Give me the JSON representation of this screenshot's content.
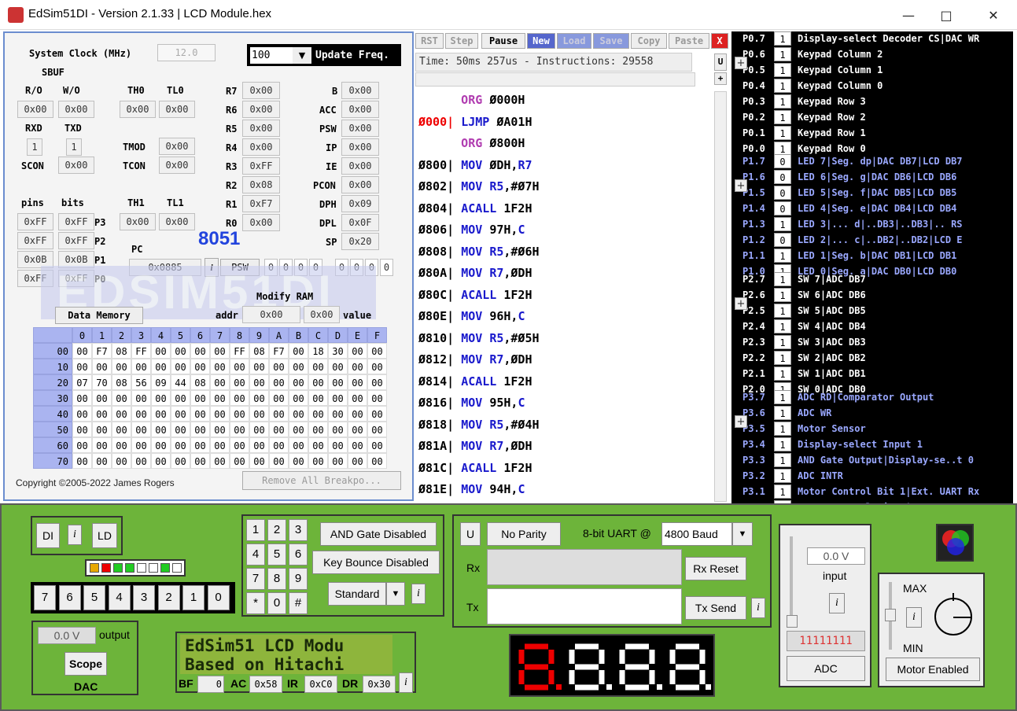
{
  "window": {
    "title": "EdSim51DI - Version 2.1.33 | LCD Module.hex"
  },
  "left": {
    "sysclock_label": "System Clock (MHz)",
    "sysclock_value": "12.0",
    "update_value": "100",
    "update_label": "Update Freq.",
    "sbuf": "SBUF",
    "ro": "R/O",
    "wo": "W/O",
    "ro_val": "0x00",
    "wo_val": "0x00",
    "rxd": "RXD",
    "txd": "TXD",
    "rxd_val": "1",
    "txd_val": "1",
    "scon": "SCON",
    "scon_val": "0x00",
    "th0": "TH0",
    "tl0": "TL0",
    "th0_val": "0x00",
    "tl0_val": "0x00",
    "tmod": "TMOD",
    "tmod_val": "0x00",
    "tcon": "TCON",
    "tcon_val": "0x00",
    "th1": "TH1",
    "tl1": "TL1",
    "th1_val": "0x00",
    "tl1_val": "0x00",
    "regs": [
      [
        "R7",
        "0x00"
      ],
      [
        "R6",
        "0x00"
      ],
      [
        "R5",
        "0x00"
      ],
      [
        "R4",
        "0x00"
      ],
      [
        "R3",
        "0xFF"
      ],
      [
        "R2",
        "0x08"
      ],
      [
        "R1",
        "0xF7"
      ],
      [
        "R0",
        "0x00"
      ]
    ],
    "sfrs": [
      [
        "B",
        "0x00"
      ],
      [
        "ACC",
        "0x00"
      ],
      [
        "PSW",
        "0x00"
      ],
      [
        "IP",
        "0x00"
      ],
      [
        "IE",
        "0x00"
      ],
      [
        "PCON",
        "0x00"
      ],
      [
        "DPH",
        "0x09"
      ],
      [
        "DPL",
        "0x0F"
      ],
      [
        "SP",
        "0x20"
      ]
    ],
    "pins": "pins",
    "bits": "bits",
    "ports": [
      [
        "0xFF",
        "0xFF",
        "P3"
      ],
      [
        "0xFF",
        "0xFF",
        "P2"
      ],
      [
        "0x0B",
        "0x0B",
        "P1"
      ],
      [
        "0xFF",
        "0xFF",
        "P0"
      ]
    ],
    "chip": "8051",
    "pc": "PC",
    "pc_val": "0x0885",
    "psw_btn": "PSW",
    "psw_bits": [
      "0",
      "0",
      "0",
      "0",
      "0",
      "0",
      "0",
      "0"
    ],
    "modify_ram": "Modify RAM",
    "addr": "addr",
    "addr_val": "0x00",
    "value_val": "0x00",
    "value": "value",
    "data_memory": "Data Memory",
    "copyright": "Copyright ©2005-2022 James Rogers",
    "remove_bp": "Remove All Breakpo...",
    "logo": "EDSIM51DI",
    "mem_cols": [
      "0",
      "1",
      "2",
      "3",
      "4",
      "5",
      "6",
      "7",
      "8",
      "9",
      "A",
      "B",
      "C",
      "D",
      "E",
      "F"
    ],
    "mem_rows": [
      [
        "00",
        "00",
        "F7",
        "08",
        "FF",
        "00",
        "00",
        "00",
        "00",
        "FF",
        "08",
        "F7",
        "00",
        "18",
        "30",
        "00",
        "00"
      ],
      [
        "10",
        "00",
        "00",
        "00",
        "00",
        "00",
        "00",
        "00",
        "00",
        "00",
        "00",
        "00",
        "00",
        "00",
        "00",
        "00",
        "00"
      ],
      [
        "20",
        "07",
        "70",
        "08",
        "56",
        "09",
        "44",
        "08",
        "00",
        "00",
        "00",
        "00",
        "00",
        "00",
        "00",
        "00",
        "00"
      ],
      [
        "30",
        "00",
        "00",
        "00",
        "00",
        "00",
        "00",
        "00",
        "00",
        "00",
        "00",
        "00",
        "00",
        "00",
        "00",
        "00",
        "00"
      ],
      [
        "40",
        "00",
        "00",
        "00",
        "00",
        "00",
        "00",
        "00",
        "00",
        "00",
        "00",
        "00",
        "00",
        "00",
        "00",
        "00",
        "00"
      ],
      [
        "50",
        "00",
        "00",
        "00",
        "00",
        "00",
        "00",
        "00",
        "00",
        "00",
        "00",
        "00",
        "00",
        "00",
        "00",
        "00",
        "00"
      ],
      [
        "60",
        "00",
        "00",
        "00",
        "00",
        "00",
        "00",
        "00",
        "00",
        "00",
        "00",
        "00",
        "00",
        "00",
        "00",
        "00",
        "00"
      ],
      [
        "70",
        "00",
        "00",
        "00",
        "00",
        "00",
        "00",
        "00",
        "00",
        "00",
        "00",
        "00",
        "00",
        "00",
        "00",
        "00",
        "00"
      ]
    ]
  },
  "code": {
    "buttons": [
      "RST",
      "Step",
      "Pause",
      "New",
      "Load",
      "Save",
      "Copy",
      "Paste",
      "X"
    ],
    "time": "Time: 50ms 257us - Instructions: 29558",
    "u": "U",
    "lines": [
      {
        "addr": "",
        "op": "ORG",
        "arg": "Ø000H",
        "kind": "org"
      },
      {
        "addr": "Ø000|",
        "op": "LJMP",
        "arg": "ØA01H",
        "kind": "bp"
      },
      {
        "addr": "",
        "op": "ORG",
        "arg": "Ø800H",
        "kind": "org"
      },
      {
        "addr": "Ø800|",
        "op": "MOV",
        "arg": "ØDH,R7",
        "kind": "n"
      },
      {
        "addr": "Ø802|",
        "op": "MOV",
        "arg": "R5,#Ø7H",
        "kind": "n"
      },
      {
        "addr": "Ø804|",
        "op": "ACALL",
        "arg": "1F2H",
        "kind": "n"
      },
      {
        "addr": "Ø806|",
        "op": "MOV",
        "arg": "97H,C",
        "kind": "n"
      },
      {
        "addr": "Ø808|",
        "op": "MOV",
        "arg": "R5,#Ø6H",
        "kind": "n"
      },
      {
        "addr": "Ø80A|",
        "op": "MOV",
        "arg": "R7,ØDH",
        "kind": "n"
      },
      {
        "addr": "Ø80C|",
        "op": "ACALL",
        "arg": "1F2H",
        "kind": "n"
      },
      {
        "addr": "Ø80E|",
        "op": "MOV",
        "arg": "96H,C",
        "kind": "n"
      },
      {
        "addr": "Ø810|",
        "op": "MOV",
        "arg": "R5,#Ø5H",
        "kind": "n"
      },
      {
        "addr": "Ø812|",
        "op": "MOV",
        "arg": "R7,ØDH",
        "kind": "n"
      },
      {
        "addr": "Ø814|",
        "op": "ACALL",
        "arg": "1F2H",
        "kind": "n"
      },
      {
        "addr": "Ø816|",
        "op": "MOV",
        "arg": "95H,C",
        "kind": "n"
      },
      {
        "addr": "Ø818|",
        "op": "MOV",
        "arg": "R5,#Ø4H",
        "kind": "n"
      },
      {
        "addr": "Ø81A|",
        "op": "MOV",
        "arg": "R7,ØDH",
        "kind": "n"
      },
      {
        "addr": "Ø81C|",
        "op": "ACALL",
        "arg": "1F2H",
        "kind": "n"
      },
      {
        "addr": "Ø81E|",
        "op": "MOV",
        "arg": "94H,C",
        "kind": "n"
      }
    ]
  },
  "ports": {
    "p0": [
      [
        "P0.7",
        "1",
        "Display-select Decoder CS|DAC WR"
      ],
      [
        "P0.6",
        "1",
        "Keypad Column 2"
      ],
      [
        "P0.5",
        "1",
        "Keypad Column 1"
      ],
      [
        "P0.4",
        "1",
        "Keypad Column 0"
      ],
      [
        "P0.3",
        "1",
        "Keypad Row 3"
      ],
      [
        "P0.2",
        "1",
        "Keypad Row 2"
      ],
      [
        "P0.1",
        "1",
        "Keypad Row 1"
      ],
      [
        "P0.0",
        "1",
        "Keypad Row 0"
      ]
    ],
    "p1": [
      [
        "P1.7",
        "0",
        "LED 7|Seg. dp|DAC DB7|LCD DB7"
      ],
      [
        "P1.6",
        "0",
        "LED 6|Seg. g|DAC DB6|LCD DB6"
      ],
      [
        "P1.5",
        "0",
        "LED 5|Seg. f|DAC DB5|LCD DB5"
      ],
      [
        "P1.4",
        "0",
        "LED 4|Seg. e|DAC DB4|LCD DB4"
      ],
      [
        "P1.3",
        "1",
        "LED 3|... d|..DB3|..DB3|.. RS"
      ],
      [
        "P1.2",
        "0",
        "LED 2|... c|..DB2|..DB2|LCD E"
      ],
      [
        "P1.1",
        "1",
        "LED 1|Seg. b|DAC DB1|LCD DB1"
      ],
      [
        "P1.0",
        "1",
        "LED 0|Seg. a|DAC DB0|LCD DB0"
      ]
    ],
    "p2": [
      [
        "P2.7",
        "1",
        "SW 7|ADC DB7"
      ],
      [
        "P2.6",
        "1",
        "SW 6|ADC DB6"
      ],
      [
        "P2.5",
        "1",
        "SW 5|ADC DB5"
      ],
      [
        "P2.4",
        "1",
        "SW 4|ADC DB4"
      ],
      [
        "P2.3",
        "1",
        "SW 3|ADC DB3"
      ],
      [
        "P2.2",
        "1",
        "SW 2|ADC DB2"
      ],
      [
        "P2.1",
        "1",
        "SW 1|ADC DB1"
      ],
      [
        "P2.0",
        "1",
        "SW 0|ADC DB0"
      ]
    ],
    "p3": [
      [
        "P3.7",
        "1",
        "ADC RD|Comparator Output"
      ],
      [
        "P3.6",
        "1",
        "ADC WR"
      ],
      [
        "P3.5",
        "1",
        "Motor Sensor"
      ],
      [
        "P3.4",
        "1",
        "Display-select Input 1"
      ],
      [
        "P3.3",
        "1",
        "AND Gate Output|Display-se..t 0"
      ],
      [
        "P3.2",
        "1",
        "ADC INTR"
      ],
      [
        "P3.1",
        "1",
        "Motor Control Bit 1|Ext. UART Rx"
      ],
      [
        "P3.0",
        "1",
        "Motor Control Bit 0|Ext. UART Tx"
      ]
    ]
  },
  "bottom": {
    "di": "DI",
    "i": "i",
    "ld": "LD",
    "switches": [
      "7",
      "6",
      "5",
      "4",
      "3",
      "2",
      "1",
      "0"
    ],
    "dac_val": "0.0 V",
    "dac_output": "output",
    "scope": "Scope",
    "dac": "DAC",
    "keys": [
      "1",
      "2",
      "3",
      "4",
      "5",
      "6",
      "7",
      "8",
      "9",
      "*",
      "0",
      "#"
    ],
    "and_gate": "AND Gate Disabled",
    "key_bounce": "Key Bounce Disabled",
    "standard": "Standard",
    "u": "U",
    "parity": "No Parity",
    "uart": "8-bit UART @",
    "baud": "4800 Baud",
    "rx": "Rx",
    "tx": "Tx",
    "rx_reset": "Rx Reset",
    "tx_send": "Tx Send",
    "lcd_line1": "EdSim51 LCD Modu",
    "lcd_line2": "Based on Hitachi",
    "bf": "BF",
    "bf_val": "0",
    "ac": "AC",
    "ac_val": "0x58",
    "ir": "IR",
    "ir_val": "0xC0",
    "dr": "DR",
    "dr_val": "0x30",
    "adc_val": "0.0 V",
    "adc_input": "input",
    "adc_bits": "11111111",
    "adc": "ADC",
    "max": "MAX",
    "min": "MIN",
    "motor": "Motor Enabled"
  }
}
